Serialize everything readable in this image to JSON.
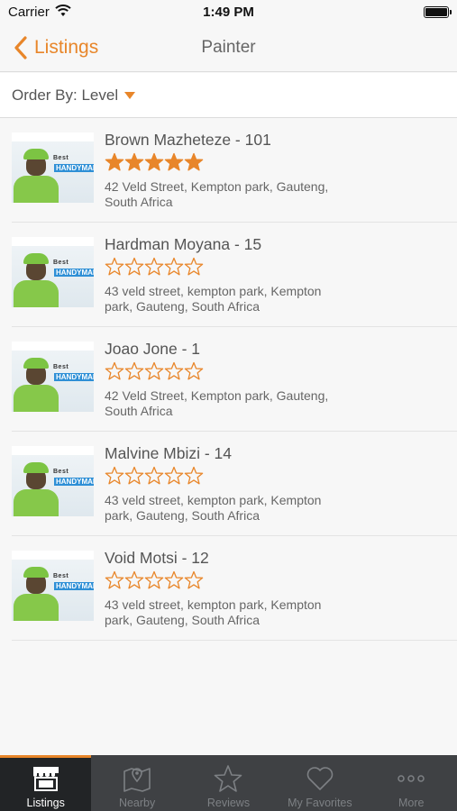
{
  "status_bar": {
    "carrier": "Carrier",
    "time": "1:49 PM"
  },
  "nav": {
    "back_label": "Listings",
    "title": "Painter"
  },
  "order_by": {
    "label": "Order By: Level"
  },
  "colors": {
    "accent": "#e8862a",
    "tab_bar_bg": "#3f4144",
    "tab_active_bg": "#222426"
  },
  "listings": [
    {
      "name": "Brown Mazheteze - 101",
      "rating": 5,
      "address": "42 Veld Street, Kempton park, Gauteng, South Africa",
      "thumb_brand_line1": "Best",
      "thumb_brand_line2": "HANDYMAN"
    },
    {
      "name": "Hardman Moyana - 15",
      "rating": 0,
      "address": "43 veld street, kempton park, Kempton park, Gauteng, South Africa",
      "thumb_brand_line1": "Best",
      "thumb_brand_line2": "HANDYMAN"
    },
    {
      "name": "Joao Jone - 1",
      "rating": 0,
      "address": "42 Veld Street, Kempton park, Gauteng, South Africa",
      "thumb_brand_line1": "Best",
      "thumb_brand_line2": "HANDYMAN"
    },
    {
      "name": "Malvine Mbizi - 14",
      "rating": 0,
      "address": "43 veld street, kempton park, Kempton park, Gauteng, South Africa",
      "thumb_brand_line1": "Best",
      "thumb_brand_line2": "HANDYMAN"
    },
    {
      "name": "Void Motsi - 12",
      "rating": 0,
      "address": "43 veld street, kempton park, Kempton park, Gauteng, South Africa",
      "thumb_brand_line1": "Best",
      "thumb_brand_line2": "HANDYMAN"
    }
  ],
  "tabs": [
    {
      "label": "Listings",
      "icon": "storefront-icon",
      "active": true
    },
    {
      "label": "Nearby",
      "icon": "map-pin-icon",
      "active": false
    },
    {
      "label": "Reviews",
      "icon": "star-icon",
      "active": false
    },
    {
      "label": "My Favorites",
      "icon": "heart-icon",
      "active": false
    },
    {
      "label": "More",
      "icon": "more-dots-icon",
      "active": false
    }
  ]
}
